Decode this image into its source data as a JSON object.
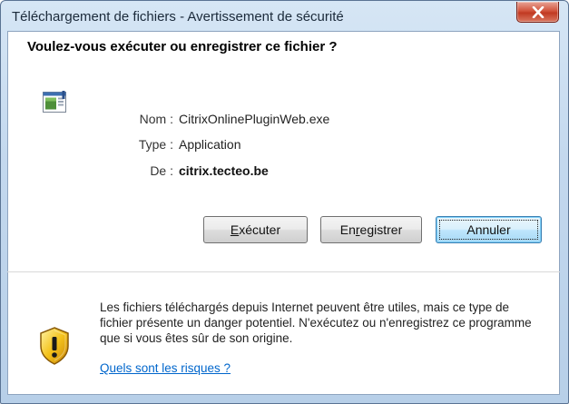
{
  "window": {
    "title": "Téléchargement de fichiers - Avertissement de sécurité",
    "close_icon": "close-icon"
  },
  "dialog": {
    "question": "Voulez-vous exécuter ou enregistrer ce fichier ?",
    "file_icon": "application-file-icon",
    "fields": [
      {
        "label": "Nom :",
        "value": "CitrixOnlinePluginWeb.exe"
      },
      {
        "label": "Type :",
        "value": "Application"
      },
      {
        "label": "De :",
        "value": "citrix.tecteo.be"
      }
    ]
  },
  "buttons": {
    "run": {
      "accel": "E",
      "rest": "xécuter"
    },
    "save": {
      "before": "En",
      "accel": "r",
      "after": "egistrer"
    },
    "cancel": "Annuler"
  },
  "warning": {
    "icon": "security-shield-warning-icon",
    "text": "Les fichiers téléchargés depuis Internet peuvent être utiles, mais ce type de fichier présente un danger potentiel. N'exécutez ou n'enregistrez ce programme que si vous êtes sûr de son origine.",
    "link": "Quels sont les risques ?"
  },
  "colors": {
    "title_bar": "#c3d8ee",
    "close_button": "#c13a22",
    "link": "#0066cc",
    "default_button_border": "#3c7fb1"
  }
}
